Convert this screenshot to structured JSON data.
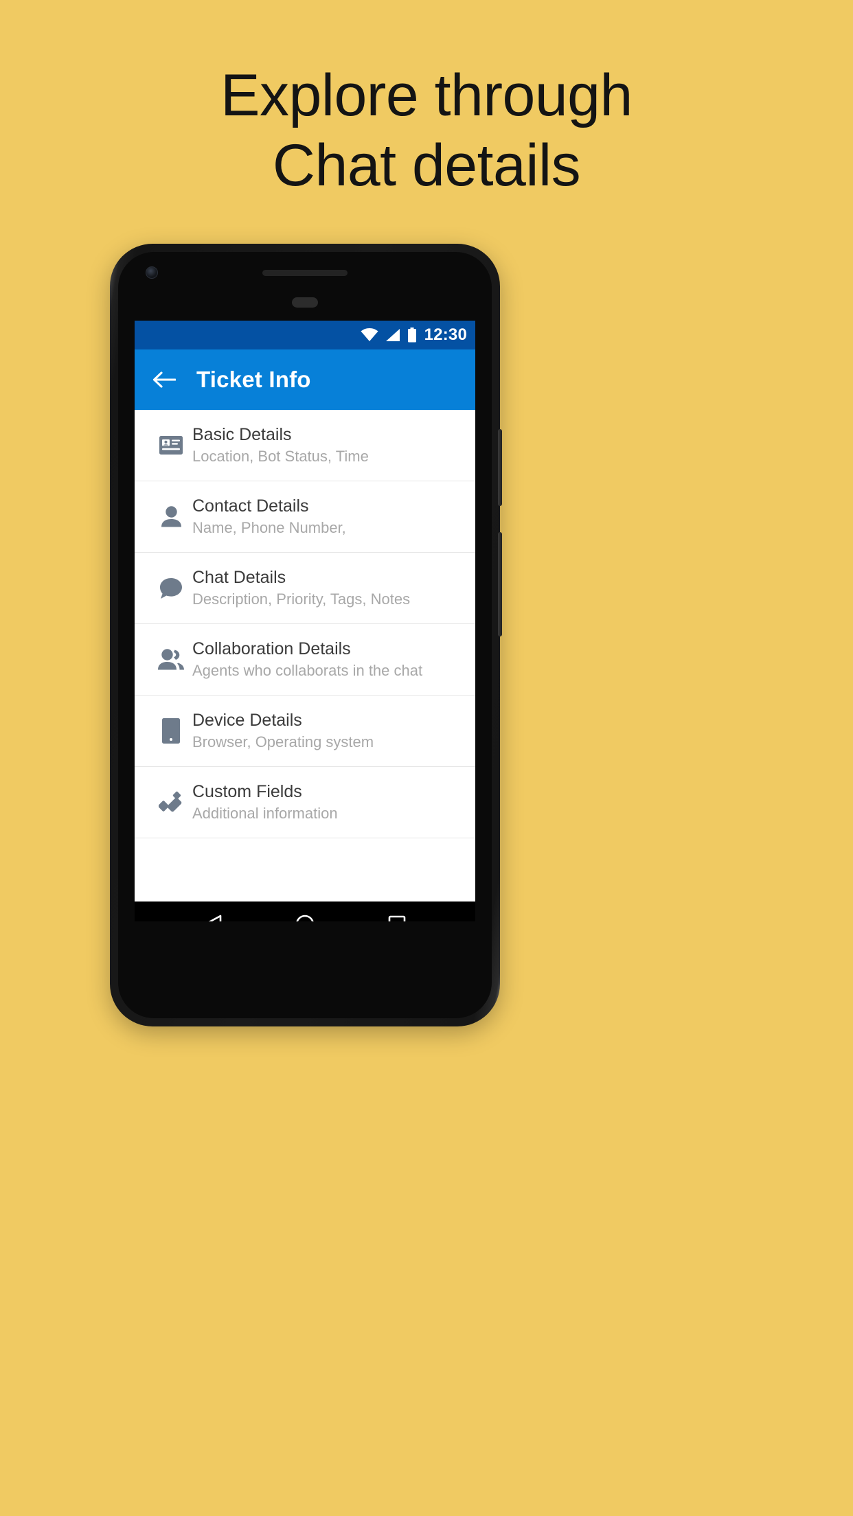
{
  "promo": {
    "background_color": "#F0CA62",
    "headline_lines": [
      "Explore through",
      "Chat details"
    ],
    "text_color": "#141414"
  },
  "device": {
    "frame_color": "#151515",
    "icons": {
      "front_camera": "front-camera-icon",
      "speaker": "earpiece-speaker",
      "proximity_sensor": "proximity-sensor"
    }
  },
  "screen": {
    "status_bar": {
      "background_color": "#0451A3",
      "time": "12:30",
      "icons": [
        "wifi-icon",
        "signal-icon",
        "battery-icon"
      ]
    },
    "app_bar": {
      "background_color": "#0780D8",
      "back_icon": "back-arrow-icon",
      "title": "Ticket Info"
    },
    "list": {
      "items": [
        {
          "icon": "contact-card-icon",
          "title": "Basic Details",
          "subtitle": "Location, Bot Status, Time"
        },
        {
          "icon": "person-icon",
          "title": "Contact Details",
          "subtitle": "Name, Phone Number,"
        },
        {
          "icon": "chat-bubble-icon",
          "title": "Chat Details",
          "subtitle": "Description, Priority, Tags, Notes"
        },
        {
          "icon": "people-group-icon",
          "title": "Collaboration Details",
          "subtitle": "Agents who collaborats in the chat"
        },
        {
          "icon": "smartphone-icon",
          "title": "Device Details",
          "subtitle": "Browser, Operating system"
        },
        {
          "icon": "custom-fields-icon",
          "title": "Custom Fields",
          "subtitle": "Additional information"
        }
      ]
    },
    "nav_bar": {
      "background_color": "#000000",
      "buttons": [
        "back-triangle-icon",
        "home-circle-icon",
        "recents-square-icon"
      ]
    }
  }
}
